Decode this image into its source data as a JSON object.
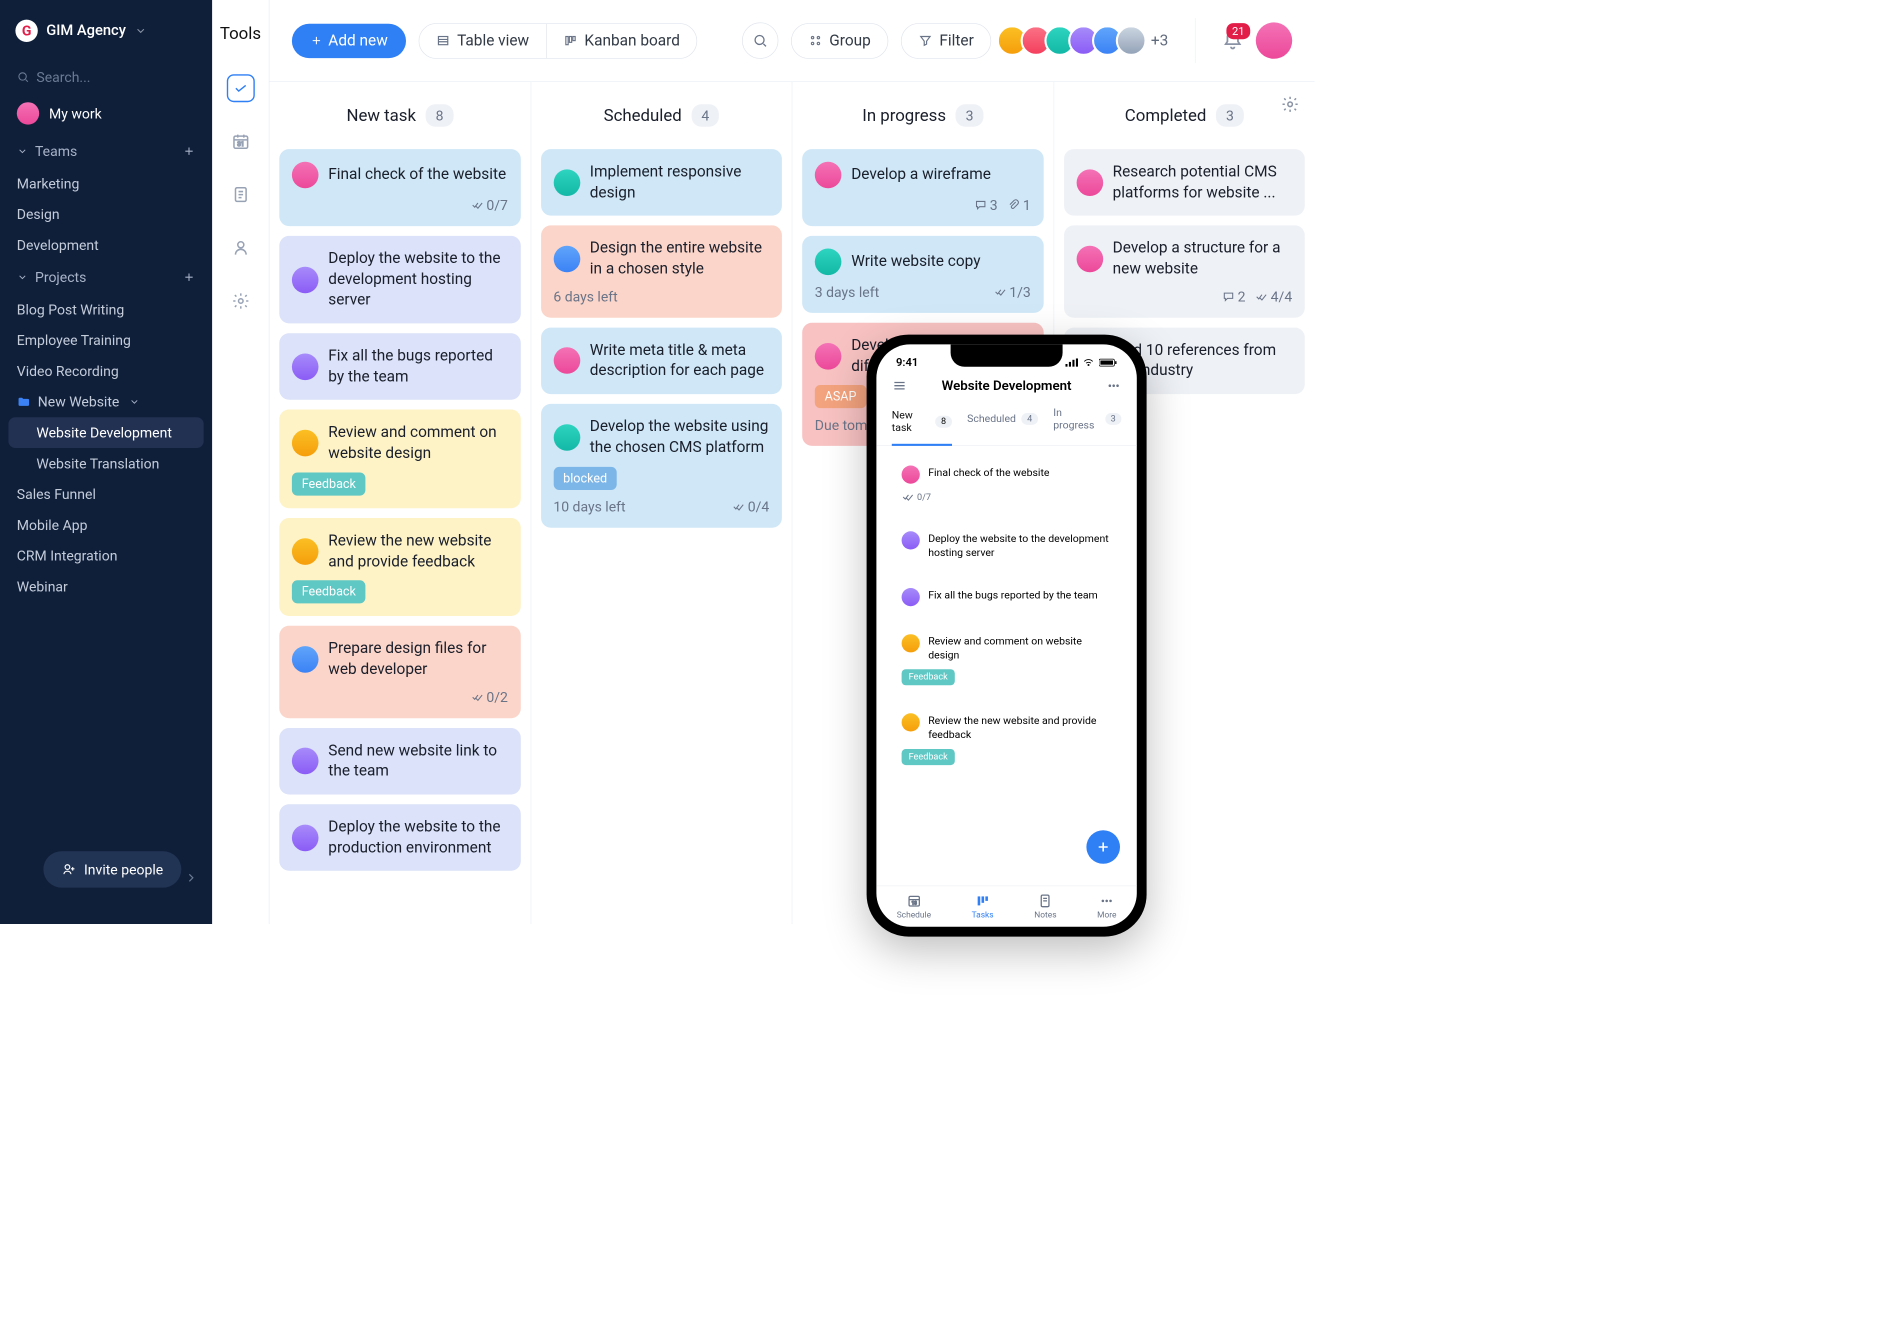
{
  "sidebar": {
    "agency": "GIM Agency",
    "search_placeholder": "Search...",
    "mywork": "My work",
    "teams_label": "Teams",
    "teams": [
      "Marketing",
      "Design",
      "Development"
    ],
    "projects_label": "Projects",
    "projects_top": [
      "Blog Post Writing",
      "Employee Training",
      "Video Recording"
    ],
    "folder": "New Website",
    "folder_children": [
      "Website Development",
      "Website Translation"
    ],
    "projects_bottom": [
      "Sales Funnel",
      "Mobile App",
      "CRM Integration",
      "Webinar"
    ],
    "invite": "Invite people"
  },
  "rail_label": "Tools",
  "topbar": {
    "add": "Add new",
    "table_view": "Table view",
    "kanban": "Kanban board",
    "group": "Group",
    "filter": "Filter",
    "more_count": "+3",
    "bell_count": "21"
  },
  "columns": [
    {
      "name": "New task",
      "count": "8"
    },
    {
      "name": "Scheduled",
      "count": "4"
    },
    {
      "name": "In progress",
      "count": "3"
    },
    {
      "name": "Completed",
      "count": "3"
    }
  ],
  "cards": {
    "c0": [
      {
        "title": "Final check of the website",
        "meta": "0/7",
        "cls": "blue",
        "av": "pink"
      },
      {
        "title": "Deploy the website to the development hosting server",
        "cls": "lav",
        "av": "purple"
      },
      {
        "title": "Fix all the bugs reported by the team",
        "cls": "lav",
        "av": "purple"
      },
      {
        "title": "Review and comment on website design",
        "tag": "Feedback",
        "cls": "yel",
        "av": "yellow"
      },
      {
        "title": "Review the new website and provide feedback",
        "tag": "Feedback",
        "cls": "yel",
        "av": "yellow"
      },
      {
        "title": "Prepare design files for web developer",
        "meta": "0/2",
        "cls": "sal",
        "av": "blue"
      },
      {
        "title": "Send new website link to the team",
        "cls": "lav",
        "av": "purple"
      },
      {
        "title": "Deploy the website to the production environment",
        "cls": "lav",
        "av": "purple"
      }
    ],
    "c1": [
      {
        "title": "Implement responsive design",
        "cls": "blue",
        "av": "teal"
      },
      {
        "title": "Design the entire website in a chosen style",
        "due": "6 days left",
        "cls": "sal",
        "av": "blue"
      },
      {
        "title": "Write meta title & meta description for each page",
        "cls": "blue",
        "av": "pink"
      },
      {
        "title": "Develop the website using the chosen CMS platform",
        "tag": "blocked",
        "due": "10 days left",
        "meta": "0/4",
        "cls": "blue",
        "av": "teal"
      }
    ],
    "c2": [
      {
        "title": "Develop a wireframe",
        "comments": "3",
        "attach": "1",
        "cls": "blue",
        "av": "pink"
      },
      {
        "title": "Write website copy",
        "due": "3 days left",
        "meta": "1/3",
        "cls": "blue",
        "av": "teal"
      },
      {
        "title": "Develop wireframes for different pages",
        "tag": "ASAP",
        "due": "Due tomorrow",
        "cls": "red",
        "av": "pink"
      }
    ],
    "c3": [
      {
        "title": "Research potential CMS platforms for website ...",
        "cls": "grey",
        "av": "pink"
      },
      {
        "title": "Develop a structure for a new website",
        "comments": "2",
        "meta": "4/4",
        "cls": "grey",
        "av": "pink"
      },
      {
        "title": "Find 10 references from the industry",
        "cls": "grey",
        "av": "gray"
      }
    ]
  },
  "phone": {
    "time": "9:41",
    "title": "Website Development",
    "tabs": [
      {
        "label": "New task",
        "count": "8"
      },
      {
        "label": "Scheduled",
        "count": "4"
      },
      {
        "label": "In progress",
        "count": "3"
      }
    ],
    "cards": [
      {
        "title": "Final check of the website",
        "meta": "0/7",
        "cls": "blue",
        "av": "pink"
      },
      {
        "title": "Deploy the website to the development hosting server",
        "cls": "lav",
        "av": "purple"
      },
      {
        "title": "Fix all the bugs reported by the team",
        "cls": "lav",
        "av": "purple"
      },
      {
        "title": "Review and comment on website design",
        "tag": "Feedback",
        "cls": "yel",
        "av": "yellow"
      },
      {
        "title": "Review the new website and provide feedback",
        "tag": "Feedback",
        "cls": "yel",
        "av": "yellow"
      }
    ],
    "nav": [
      "Schedule",
      "Tasks",
      "Notes",
      "More"
    ]
  }
}
